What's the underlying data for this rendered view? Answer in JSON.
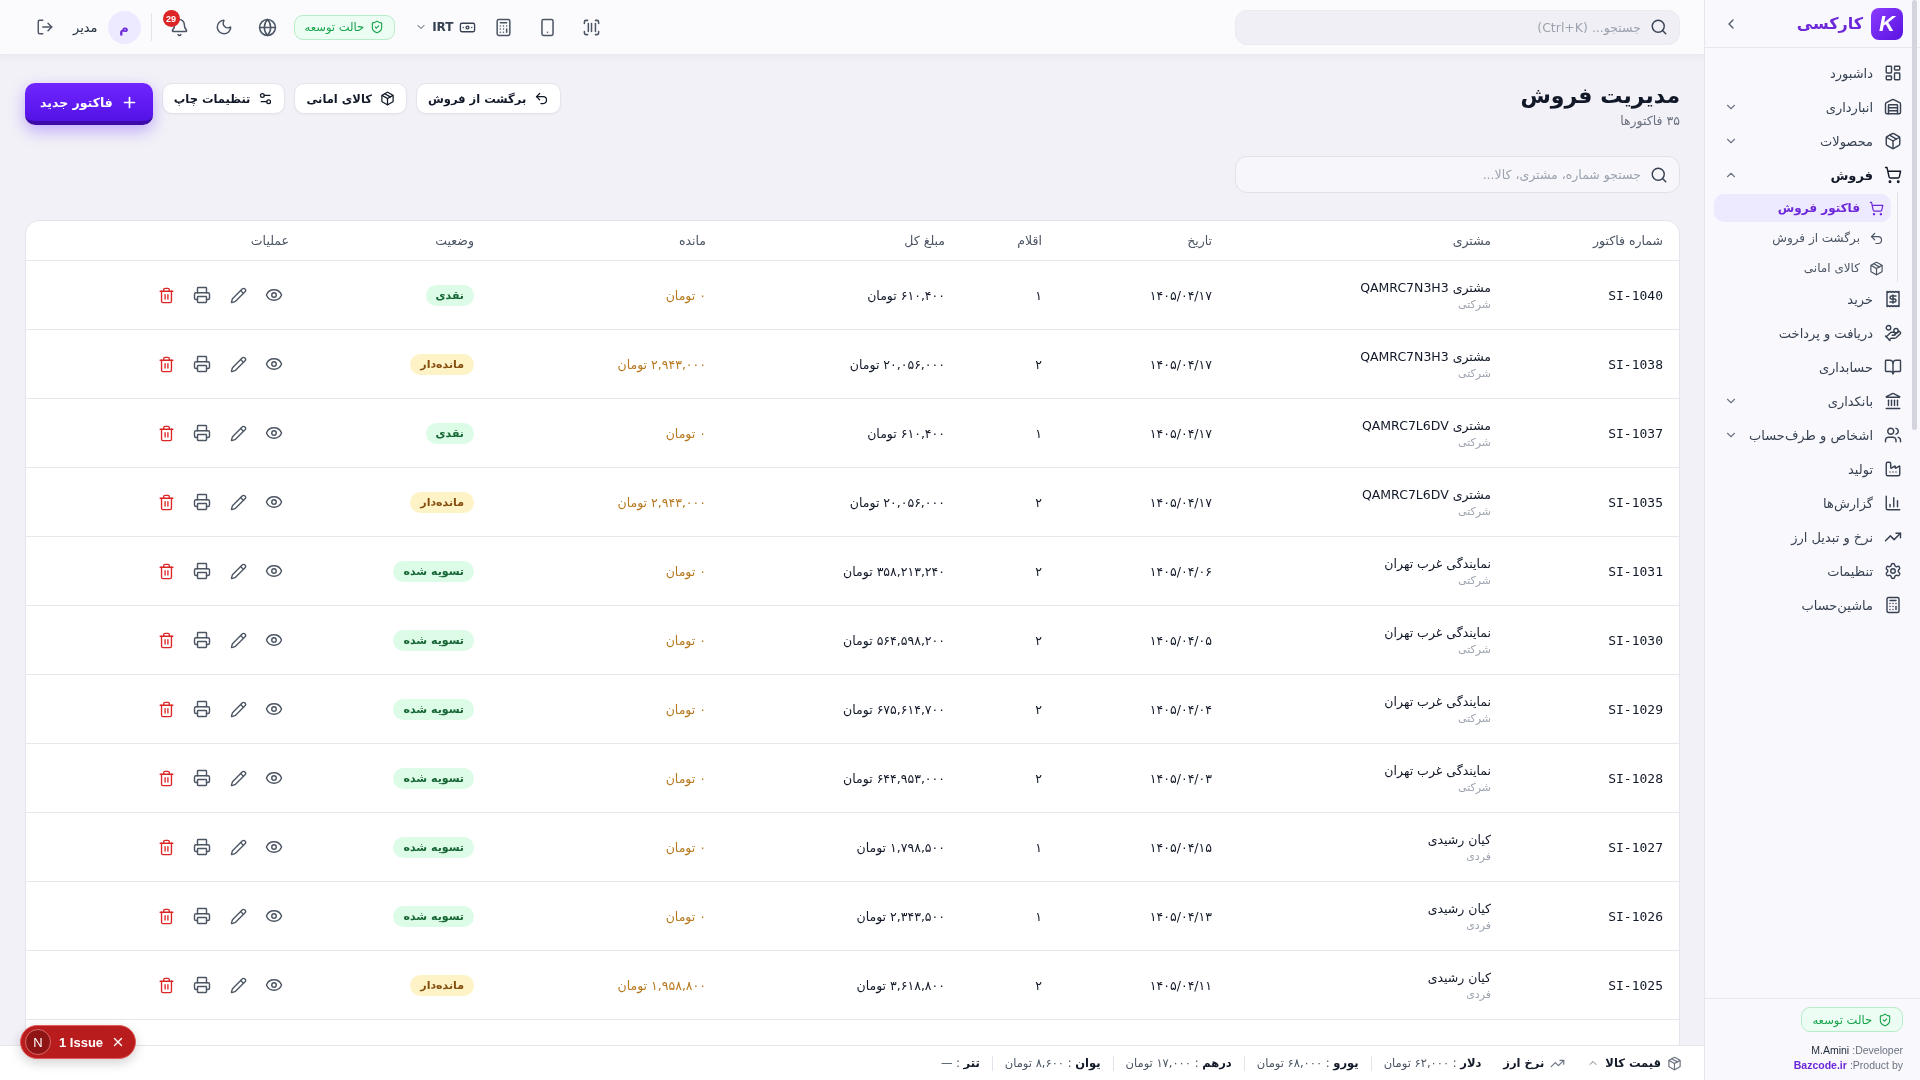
{
  "sidebar": {
    "logo": "K",
    "brand": "کارکسی",
    "items": [
      {
        "label": "داشبورد",
        "selected": false
      },
      {
        "label": "انبارداری",
        "selected": false,
        "expanded": false
      },
      {
        "label": "محصولات",
        "selected": false,
        "expanded": false
      },
      {
        "label": "فروش",
        "selected": false,
        "expanded": true,
        "children": [
          {
            "label": "فاکتور فروش",
            "selected": true
          },
          {
            "label": "برگشت از فروش",
            "selected": false
          },
          {
            "label": "کالای امانی",
            "selected": false
          }
        ]
      },
      {
        "label": "خرید",
        "selected": false
      },
      {
        "label": "دریافت و پرداخت",
        "selected": false
      },
      {
        "label": "حسابداری",
        "selected": false
      },
      {
        "label": "بانکداری",
        "selected": false,
        "expanded": false
      },
      {
        "label": "اشخاص و طرف‌حساب",
        "selected": false,
        "expanded": false
      },
      {
        "label": "تولید",
        "selected": false
      },
      {
        "label": "گزارش‌ها",
        "selected": false
      },
      {
        "label": "نرخ و تبدیل ارز",
        "selected": false
      },
      {
        "label": "تنظیمات",
        "selected": false
      },
      {
        "label": "ماشین‌حساب",
        "selected": false
      }
    ],
    "footer": {
      "mode": "حالت توسعه",
      "developer_label": "Developer:",
      "developer": "M.Amini",
      "product_label": "Product by:",
      "product": "Bazcode.ir"
    }
  },
  "top_bar": {
    "search": {
      "placeholder": "جستجو... (Ctrl+K)"
    },
    "currency": "IRT",
    "mode": "حالت توسعه",
    "notifications": "29",
    "user": {
      "initial": "م",
      "name": "مدیر"
    }
  },
  "page": {
    "title": "مدیریت فروش",
    "subtitle": "۳۵ فاکتورها",
    "actions": [
      {
        "label": "برگشت از فروش",
        "kind": "secondary"
      },
      {
        "label": "کالای امانی",
        "kind": "secondary"
      },
      {
        "label": "تنظیمات چاپ",
        "kind": "secondary"
      },
      {
        "label": "فاکتور جدید",
        "kind": "primary"
      }
    ],
    "search": {
      "placeholder": "جستجو شماره، مشتری، کالا..."
    }
  },
  "table": {
    "columns": [
      "شماره فاکتور",
      "مشتری",
      "تاریخ",
      "اقلام",
      "مبلغ کل",
      "مانده",
      "وضعیت",
      "عملیات"
    ],
    "rows": [
      {
        "number": "SI-1040",
        "customer": "مشتری QAMRC7N3H3",
        "customer_type": "شرکتی",
        "date": "۱۴۰۵/۰۴/۱۷",
        "items": "۱",
        "total": "۶۱۰,۴۰۰ تومان",
        "balance": "۰ تومان",
        "status": {
          "label": "نقدی",
          "kind": "success"
        }
      },
      {
        "number": "SI-1038",
        "customer": "مشتری QAMRC7N3H3",
        "customer_type": "شرکتی",
        "date": "۱۴۰۵/۰۴/۱۷",
        "items": "۲",
        "total": "۲۰,۰۵۶,۰۰۰ تومان",
        "balance": "۲,۹۴۳,۰۰۰ تومان",
        "status": {
          "label": "مانده‌دار",
          "kind": "warning"
        }
      },
      {
        "number": "SI-1037",
        "customer": "مشتری QAMRC7L6DV",
        "customer_type": "شرکتی",
        "date": "۱۴۰۵/۰۴/۱۷",
        "items": "۱",
        "total": "۶۱۰,۴۰۰ تومان",
        "balance": "۰ تومان",
        "status": {
          "label": "نقدی",
          "kind": "success"
        }
      },
      {
        "number": "SI-1035",
        "customer": "مشتری QAMRC7L6DV",
        "customer_type": "شرکتی",
        "date": "۱۴۰۵/۰۴/۱۷",
        "items": "۲",
        "total": "۲۰,۰۵۶,۰۰۰ تومان",
        "balance": "۲,۹۴۳,۰۰۰ تومان",
        "status": {
          "label": "مانده‌دار",
          "kind": "warning"
        }
      },
      {
        "number": "SI-1031",
        "customer": "نمایندگی غرب تهران",
        "customer_type": "شرکتی",
        "date": "۱۴۰۵/۰۴/۰۶",
        "items": "۲",
        "total": "۳۵۸,۲۱۳,۲۴۰ تومان",
        "balance": "۰ تومان",
        "status": {
          "label": "تسویه شده",
          "kind": "success"
        }
      },
      {
        "number": "SI-1030",
        "customer": "نمایندگی غرب تهران",
        "customer_type": "شرکتی",
        "date": "۱۴۰۵/۰۴/۰۵",
        "items": "۲",
        "total": "۵۶۴,۵۹۸,۲۰۰ تومان",
        "balance": "۰ تومان",
        "status": {
          "label": "تسویه شده",
          "kind": "success"
        }
      },
      {
        "number": "SI-1029",
        "customer": "نمایندگی غرب تهران",
        "customer_type": "شرکتی",
        "date": "۱۴۰۵/۰۴/۰۴",
        "items": "۲",
        "total": "۶۷۵,۶۱۴,۷۰۰ تومان",
        "balance": "۰ تومان",
        "status": {
          "label": "تسویه شده",
          "kind": "success"
        }
      },
      {
        "number": "SI-1028",
        "customer": "نمایندگی غرب تهران",
        "customer_type": "شرکتی",
        "date": "۱۴۰۵/۰۴/۰۳",
        "items": "۲",
        "total": "۶۴۴,۹۵۳,۰۰۰ تومان",
        "balance": "۰ تومان",
        "status": {
          "label": "تسویه شده",
          "kind": "success"
        }
      },
      {
        "number": "SI-1027",
        "customer": "کیان رشیدی",
        "customer_type": "فردی",
        "date": "۱۴۰۵/۰۴/۱۵",
        "items": "۱",
        "total": "۱,۷۹۸,۵۰۰ تومان",
        "balance": "۰ تومان",
        "status": {
          "label": "تسویه شده",
          "kind": "success"
        }
      },
      {
        "number": "SI-1026",
        "customer": "کیان رشیدی",
        "customer_type": "فردی",
        "date": "۱۴۰۵/۰۴/۱۳",
        "items": "۱",
        "total": "۲,۳۴۳,۵۰۰ تومان",
        "balance": "۰ تومان",
        "status": {
          "label": "تسویه شده",
          "kind": "success"
        }
      },
      {
        "number": "SI-1025",
        "customer": "کیان رشیدی",
        "customer_type": "فردی",
        "date": "۱۴۰۵/۰۴/۱۱",
        "items": "۲",
        "total": "۳,۶۱۸,۸۰۰ تومان",
        "balance": "۱,۹۵۸,۸۰۰ تومان",
        "status": {
          "label": "مانده‌دار",
          "kind": "warning"
        }
      }
    ]
  },
  "bottom_bar": {
    "panels": [
      {
        "label": "قیمت کالا",
        "expanded": false
      },
      {
        "label": "نرخ ارز"
      }
    ],
    "rates": [
      "**دلار** : ۶۲,۰۰۰ تومان",
      "**یورو** : ۶۸,۰۰۰ تومان",
      "**درهم** : ۱۷,۰۰۰ تومان",
      "**یوان** : ۸,۶۰۰ تومان",
      "**تتر** : —"
    ]
  },
  "dev_indicator": {
    "logo": "N",
    "label": "1 Issue"
  }
}
